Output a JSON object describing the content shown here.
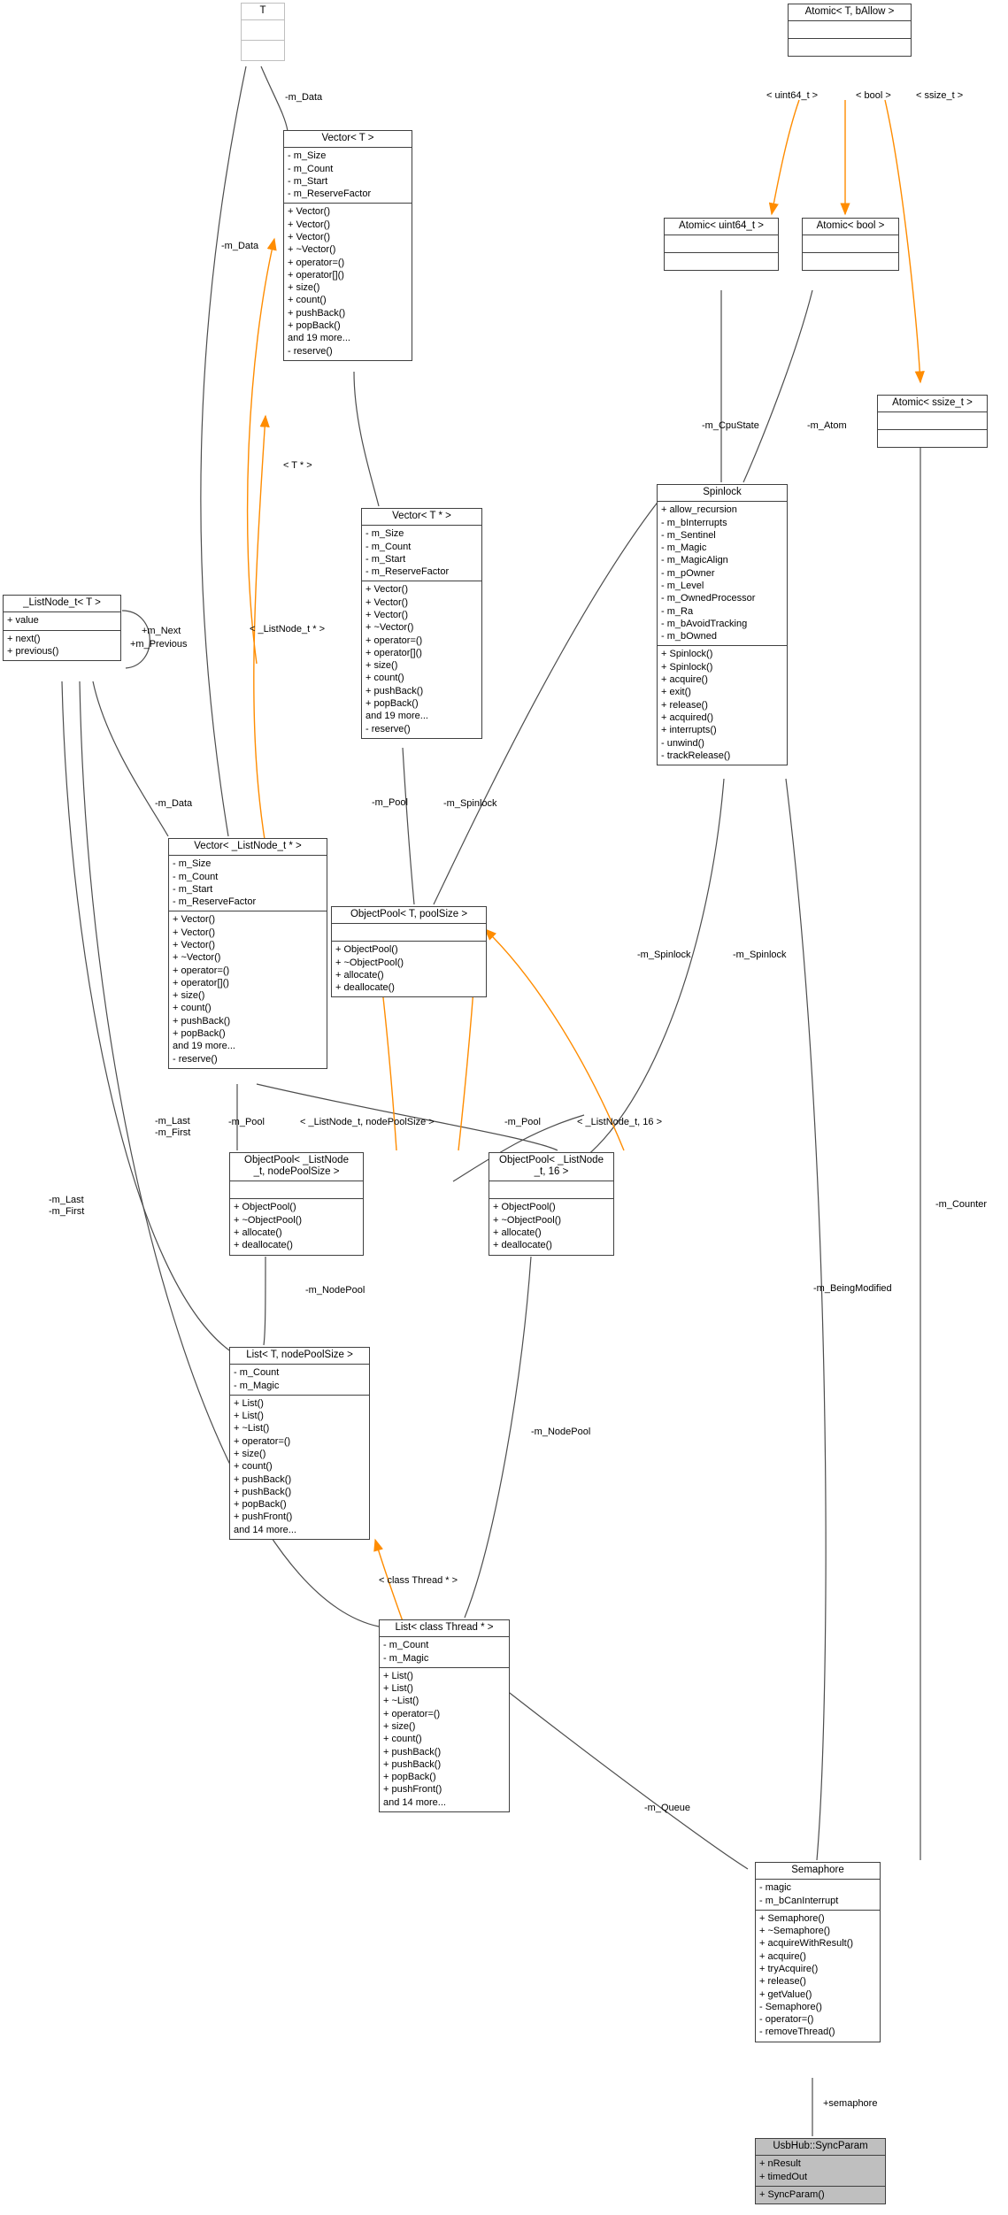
{
  "diagram": {
    "title": "Collaboration diagram for UsbHub::SyncParam",
    "colors": {
      "inheritance_edge": "#ff8c00",
      "association_edge": "#4d4d4d",
      "node_border": "#404040",
      "template_border": "#bfbfbf",
      "highlight_fill": "#bfbfbf"
    }
  },
  "nodes": {
    "t": {
      "title": "T",
      "attrs": [],
      "ops": []
    },
    "vector_t": {
      "title": "Vector< T >",
      "attrs": [
        "- m_Size",
        "- m_Count",
        "- m_Start",
        "- m_ReserveFactor"
      ],
      "ops": [
        "+ Vector()",
        "+ Vector()",
        "+ Vector()",
        "+ ~Vector()",
        "+ operator=()",
        "+ operator[]()",
        "+ size()",
        "+ count()",
        "+ pushBack()",
        "+ popBack()",
        "and 19 more...",
        "- reserve()"
      ]
    },
    "vector_tptr": {
      "title": "Vector< T * >",
      "attrs": [
        "- m_Size",
        "- m_Count",
        "- m_Start",
        "- m_ReserveFactor"
      ],
      "ops": [
        "+ Vector()",
        "+ Vector()",
        "+ Vector()",
        "+ ~Vector()",
        "+ operator=()",
        "+ operator[]()",
        "+ size()",
        "+ count()",
        "+ pushBack()",
        "+ popBack()",
        "and 19 more...",
        "- reserve()"
      ]
    },
    "vector_listnode": {
      "title": "Vector< _ListNode_t * >",
      "attrs": [
        "- m_Size",
        "- m_Count",
        "- m_Start",
        "- m_ReserveFactor"
      ],
      "ops": [
        "+ Vector()",
        "+ Vector()",
        "+ Vector()",
        "+ ~Vector()",
        "+ operator=()",
        "+ operator[]()",
        "+ size()",
        "+ count()",
        "+ pushBack()",
        "+ popBack()",
        "and 19 more...",
        "- reserve()"
      ]
    },
    "listnode_t": {
      "title": "_ListNode_t< T >",
      "attrs": [
        "+ value"
      ],
      "ops": [
        "+ next()",
        "+ previous()"
      ]
    },
    "atomic_generic": {
      "title": "Atomic< T, bAllow >",
      "attrs": [],
      "ops": []
    },
    "atomic_uint64": {
      "title": "Atomic< uint64_t >",
      "attrs": [],
      "ops": []
    },
    "atomic_bool": {
      "title": "Atomic< bool >",
      "attrs": [],
      "ops": []
    },
    "atomic_ssize": {
      "title": "Atomic< ssize_t >",
      "attrs": [],
      "ops": []
    },
    "spinlock": {
      "title": "Spinlock",
      "attrs": [
        "+ allow_recursion",
        "- m_bInterrupts",
        "- m_Sentinel",
        "- m_Magic",
        "- m_MagicAlign",
        "- m_pOwner",
        "- m_Level",
        "- m_OwnedProcessor",
        "- m_Ra",
        "- m_bAvoidTracking",
        "- m_bOwned"
      ],
      "ops": [
        "+ Spinlock()",
        "+ Spinlock()",
        "+ acquire()",
        "+ exit()",
        "+ release()",
        "+ acquired()",
        "+ interrupts()",
        "- unwind()",
        "- trackRelease()"
      ]
    },
    "objectpool_generic": {
      "title": "ObjectPool< T, poolSize >",
      "attrs": [],
      "ops": [
        "+ ObjectPool()",
        "+ ~ObjectPool()",
        "+ allocate()",
        "+ deallocate()"
      ]
    },
    "objectpool_nodepool": {
      "title": "ObjectPool< _ListNode\n_t, nodePoolSize >",
      "title_line1": "ObjectPool< _ListNode",
      "title_line2": "_t, nodePoolSize >",
      "attrs": [],
      "ops": [
        "+ ObjectPool()",
        "+ ~ObjectPool()",
        "+ allocate()",
        "+ deallocate()"
      ]
    },
    "objectpool_16": {
      "title": "ObjectPool< _ListNode\n_t, 16 >",
      "title_line1": "ObjectPool< _ListNode",
      "title_line2": "_t, 16 >",
      "attrs": [],
      "ops": [
        "+ ObjectPool()",
        "+ ~ObjectPool()",
        "+ allocate()",
        "+ deallocate()"
      ]
    },
    "list_generic": {
      "title": "List< T, nodePoolSize >",
      "attrs": [
        "- m_Count",
        "- m_Magic"
      ],
      "ops": [
        "+ List()",
        "+ List()",
        "+ ~List()",
        "+ operator=()",
        "+ size()",
        "+ count()",
        "+ pushBack()",
        "+ pushBack()",
        "+ popBack()",
        "+ pushFront()",
        "and 14 more..."
      ]
    },
    "list_thread": {
      "title": "List< class Thread * >",
      "attrs": [
        "- m_Count",
        "- m_Magic"
      ],
      "ops": [
        "+ List()",
        "+ List()",
        "+ ~List()",
        "+ operator=()",
        "+ size()",
        "+ count()",
        "+ pushBack()",
        "+ pushBack()",
        "+ popBack()",
        "+ pushFront()",
        "and 14 more..."
      ]
    },
    "semaphore": {
      "title": "Semaphore",
      "attrs": [
        "- magic",
        "- m_bCanInterrupt"
      ],
      "ops": [
        "+ Semaphore()",
        "+ ~Semaphore()",
        "+ acquireWithResult()",
        "+ acquire()",
        "+ tryAcquire()",
        "+ release()",
        "+ getValue()",
        "- Semaphore()",
        "- operator=()",
        "- removeThread()"
      ]
    },
    "syncparam": {
      "title": "UsbHub::SyncParam",
      "attrs": [
        "+ nResult",
        "+ timedOut"
      ],
      "ops": [
        "+ SyncParam()"
      ]
    }
  },
  "edge_labels": {
    "m_data_top": "-m_Data",
    "m_data_left": "-m_Data",
    "m_data_listnode": "-m_Data",
    "m_next": "+m_Next",
    "m_previous": "+m_Previous",
    "m_pool_a": "-m_Pool",
    "m_pool_b": "-m_Pool",
    "m_pool_c": "-m_Pool",
    "m_spinlock_a": "-m_Spinlock",
    "m_spinlock_b": "-m_Spinlock",
    "m_spinlock_c": "-m_Spinlock",
    "m_cpustate": "-m_CpuState",
    "m_atom": "-m_Atom",
    "m_counter": "-m_Counter",
    "m_beingmodified": "-m_BeingModified",
    "m_nodepool_a": "-m_NodePool",
    "m_nodepool_b": "-m_NodePool",
    "m_last_first_a": "-m_Last",
    "m_last_first_a2": "-m_First",
    "m_last_first_b": "-m_Last",
    "m_last_first_b2": "-m_First",
    "m_queue": "-m_Queue",
    "semaphore_role": "+semaphore"
  },
  "template_labels": {
    "t_ptr": "< T * >",
    "listnode_ptr": "< _ListNode_t * >",
    "uint64": "< uint64_t >",
    "bool": "< bool >",
    "ssize": "< ssize_t >",
    "listnode_nodepool": "< _ListNode_t, nodePoolSize >",
    "listnode_16": "< _ListNode_t, 16 >",
    "class_thread": "< class Thread * >"
  }
}
